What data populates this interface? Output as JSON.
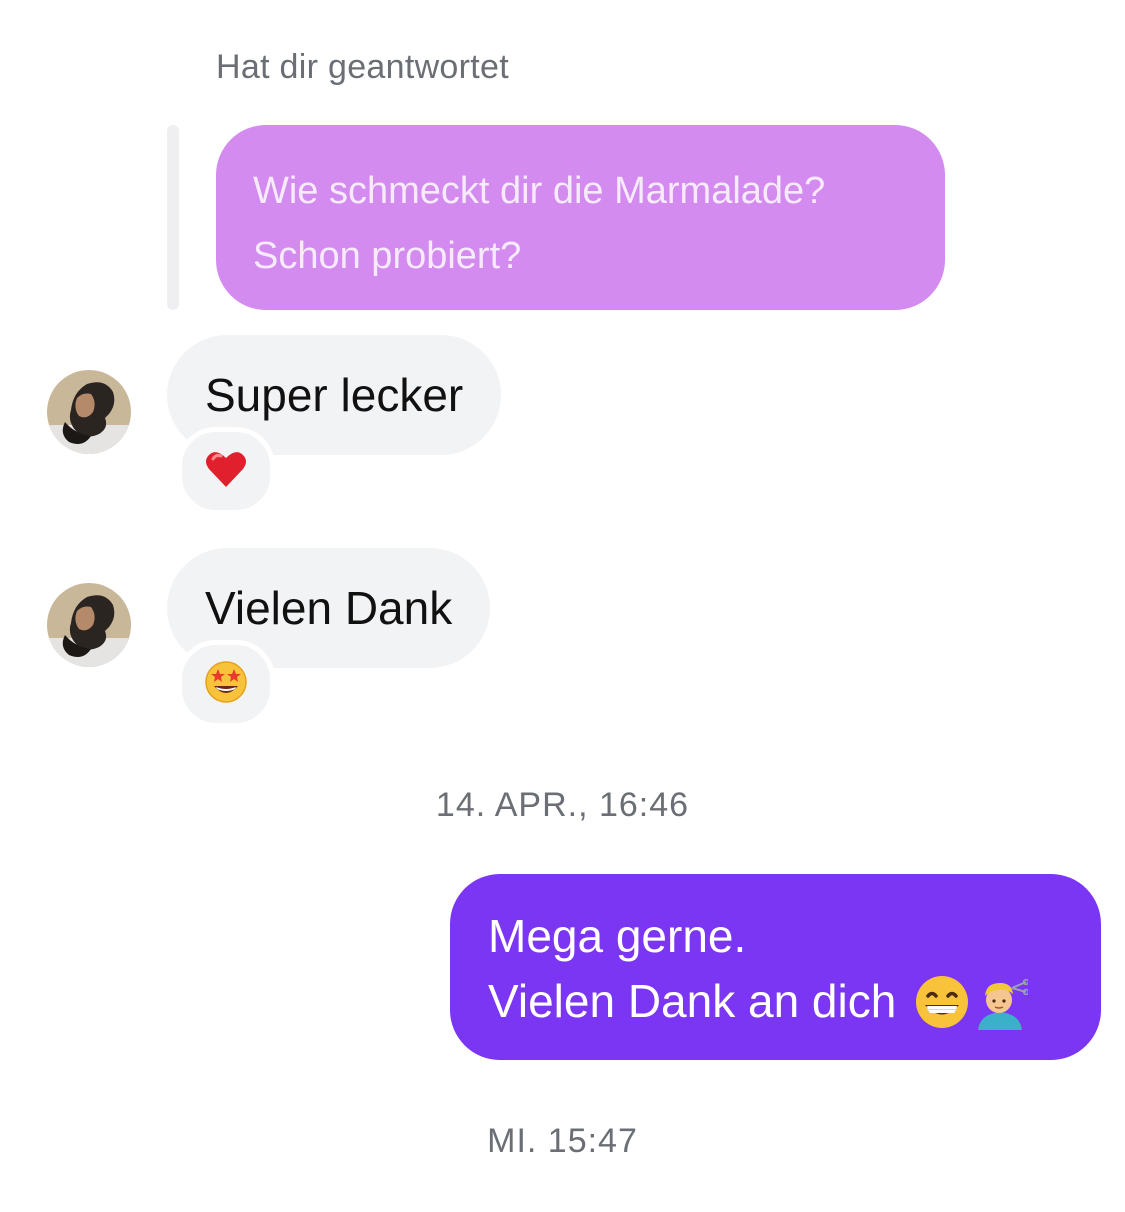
{
  "reply_context": {
    "label": "Hat dir geantwortet",
    "quoted_lines": [
      "Wie schmeckt dir die Marmalade?",
      "Schon probiert?"
    ]
  },
  "messages": [
    {
      "sender": "contact",
      "text": "Super lecker",
      "reaction": "red-heart"
    },
    {
      "sender": "contact",
      "text": "Vielen Dank",
      "reaction": "star-struck"
    }
  ],
  "timestamps": [
    "14. APR., 16:46",
    "MI. 15:47"
  ],
  "outgoing": {
    "lines": [
      "Mega gerne.",
      "Vielen Dank an dich"
    ],
    "emojis": [
      "grinning-face-with-smiling-eyes",
      "man-getting-haircut"
    ]
  },
  "colors": {
    "outgoing_bubble": "#7b36f4",
    "reply_bubble": "#d38bef",
    "incoming_bubble": "#f2f3f5"
  }
}
